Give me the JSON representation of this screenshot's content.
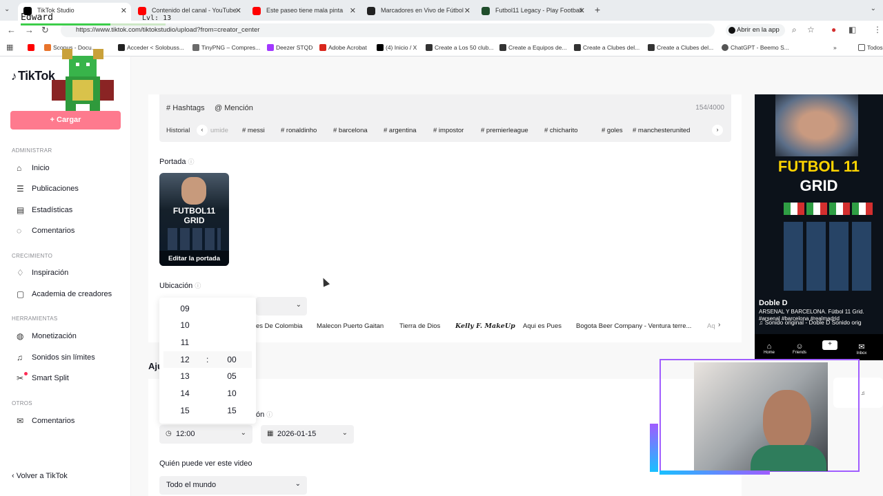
{
  "browser": {
    "tabs": [
      {
        "title": "TikTok Studio",
        "active": true,
        "color": "#000000"
      },
      {
        "title": "Contenido del canal - YouTube",
        "active": false,
        "color": "#ff0000"
      },
      {
        "title": "Este paseo tiene mala pinta",
        "active": false,
        "color": "#ff0000"
      },
      {
        "title": "Marcadores en Vivo de Fútbol",
        "active": false,
        "color": "#222222"
      },
      {
        "title": "Futbol11 Legacy - Play Football",
        "active": false,
        "color": "#1f4d2b"
      }
    ],
    "url": "https://www.tiktok.com/tiktokstudio/upload?from=creator_center",
    "open_app_label": "Abrir en la app",
    "bookmarks": [
      {
        "label": "",
        "color": "#ff0000"
      },
      {
        "label": "Scopus - Docu...",
        "color": "#e8742c"
      },
      {
        "label": "Acceder < Solobuss...",
        "color": "#222222"
      },
      {
        "label": "TinyPNG – Compres...",
        "color": "#6b6b6b"
      },
      {
        "label": "Deezer STQD",
        "color": "#a238ff"
      },
      {
        "label": "Adobe Acrobat",
        "color": "#d9261c"
      },
      {
        "label": "(4) Inicio / X",
        "color": "#000000"
      },
      {
        "label": "Create a Los 50 club...",
        "color": "#333333"
      },
      {
        "label": "Create a Equipos de...",
        "color": "#333333"
      },
      {
        "label": "Create a Clubes del...",
        "color": "#333333"
      },
      {
        "label": "Create a Clubes del...",
        "color": "#333333"
      },
      {
        "label": "ChatGPT - Beemo S...",
        "color": "#555555"
      }
    ],
    "bookmarks_all_label": "Todos"
  },
  "stream_overlay": {
    "username": "Edward",
    "level": "Lvl: 13",
    "xp_fraction": 0.62
  },
  "sidebar": {
    "logo": "TikTok",
    "upload_label": "+ Cargar",
    "sections": [
      {
        "title": "ADMINISTRAR",
        "items": [
          {
            "label": "Inicio",
            "icon": "home-icon"
          },
          {
            "label": "Publicaciones",
            "icon": "list-icon"
          },
          {
            "label": "Estadísticas",
            "icon": "chart-icon"
          },
          {
            "label": "Comentarios",
            "icon": "comment-icon"
          }
        ]
      },
      {
        "title": "CRECIMIENTO",
        "items": [
          {
            "label": "Inspiración",
            "icon": "bulb-icon"
          },
          {
            "label": "Academia de creadores",
            "icon": "book-icon"
          }
        ]
      },
      {
        "title": "HERRAMIENTAS",
        "items": [
          {
            "label": "Monetización",
            "icon": "coin-icon"
          },
          {
            "label": "Sonidos sin límites",
            "icon": "music-icon"
          },
          {
            "label": "Smart Split",
            "icon": "scissors-icon"
          }
        ]
      },
      {
        "title": "OTROS",
        "items": [
          {
            "label": "Comentarios",
            "icon": "mail-icon"
          }
        ]
      }
    ],
    "back_label": "Volver a TikTok"
  },
  "hashtag_bar": {
    "hashtags_label": "Hashtags",
    "mention_label": "Mención",
    "counter": "154/4000",
    "history_label": "Historial",
    "chips": [
      "umide",
      "# messi",
      "# ronaldinho",
      "# barcelona",
      "# argentina",
      "# impostor",
      "# premierleague",
      "# chicharito",
      "# goles",
      "# manchesterunited"
    ]
  },
  "cover": {
    "label": "Portada",
    "thumb_line1": "FUTBOL11",
    "thumb_line2": "GRID",
    "edit_label": "Editar la portada"
  },
  "location": {
    "label": "Ubicación",
    "suggestions": [
      "es De Colombia",
      "Malecon Puerto Gaitan",
      "Tierra de Dios",
      "Kelly F. MakeUp",
      "Aqui es Pues",
      "Bogota Beer Company - Ventura terre...",
      "Aq"
    ]
  },
  "time_picker": {
    "hours": [
      "09",
      "10",
      "11",
      "12",
      "13",
      "14",
      "15"
    ],
    "minutes": [
      "00",
      "05",
      "10",
      "15"
    ],
    "separator": ":"
  },
  "schedule": {
    "partial_heading": "Aju",
    "label_partial": "ón",
    "time_value": "12:00",
    "date_value": "2026-01-15"
  },
  "visibility": {
    "label": "Quién puede ver este video",
    "value": "Todo el mundo"
  },
  "phone_preview": {
    "title_line1": "FUTBOL 11",
    "title_line2": "GRID",
    "author": "Doble D",
    "description": "ARSENAL Y BARCELONA. Fútbol 11 Grid. #arsenal #barcelona #realmadrid",
    "sound": "♫ Sonido original - Doble D   Sonido orig",
    "nav": [
      "Home",
      "Friends",
      "Inbox"
    ]
  },
  "colors": {
    "upload_button": "#fe7a8e",
    "accent": "#fe2c55",
    "phone_title": "#ffd400"
  }
}
